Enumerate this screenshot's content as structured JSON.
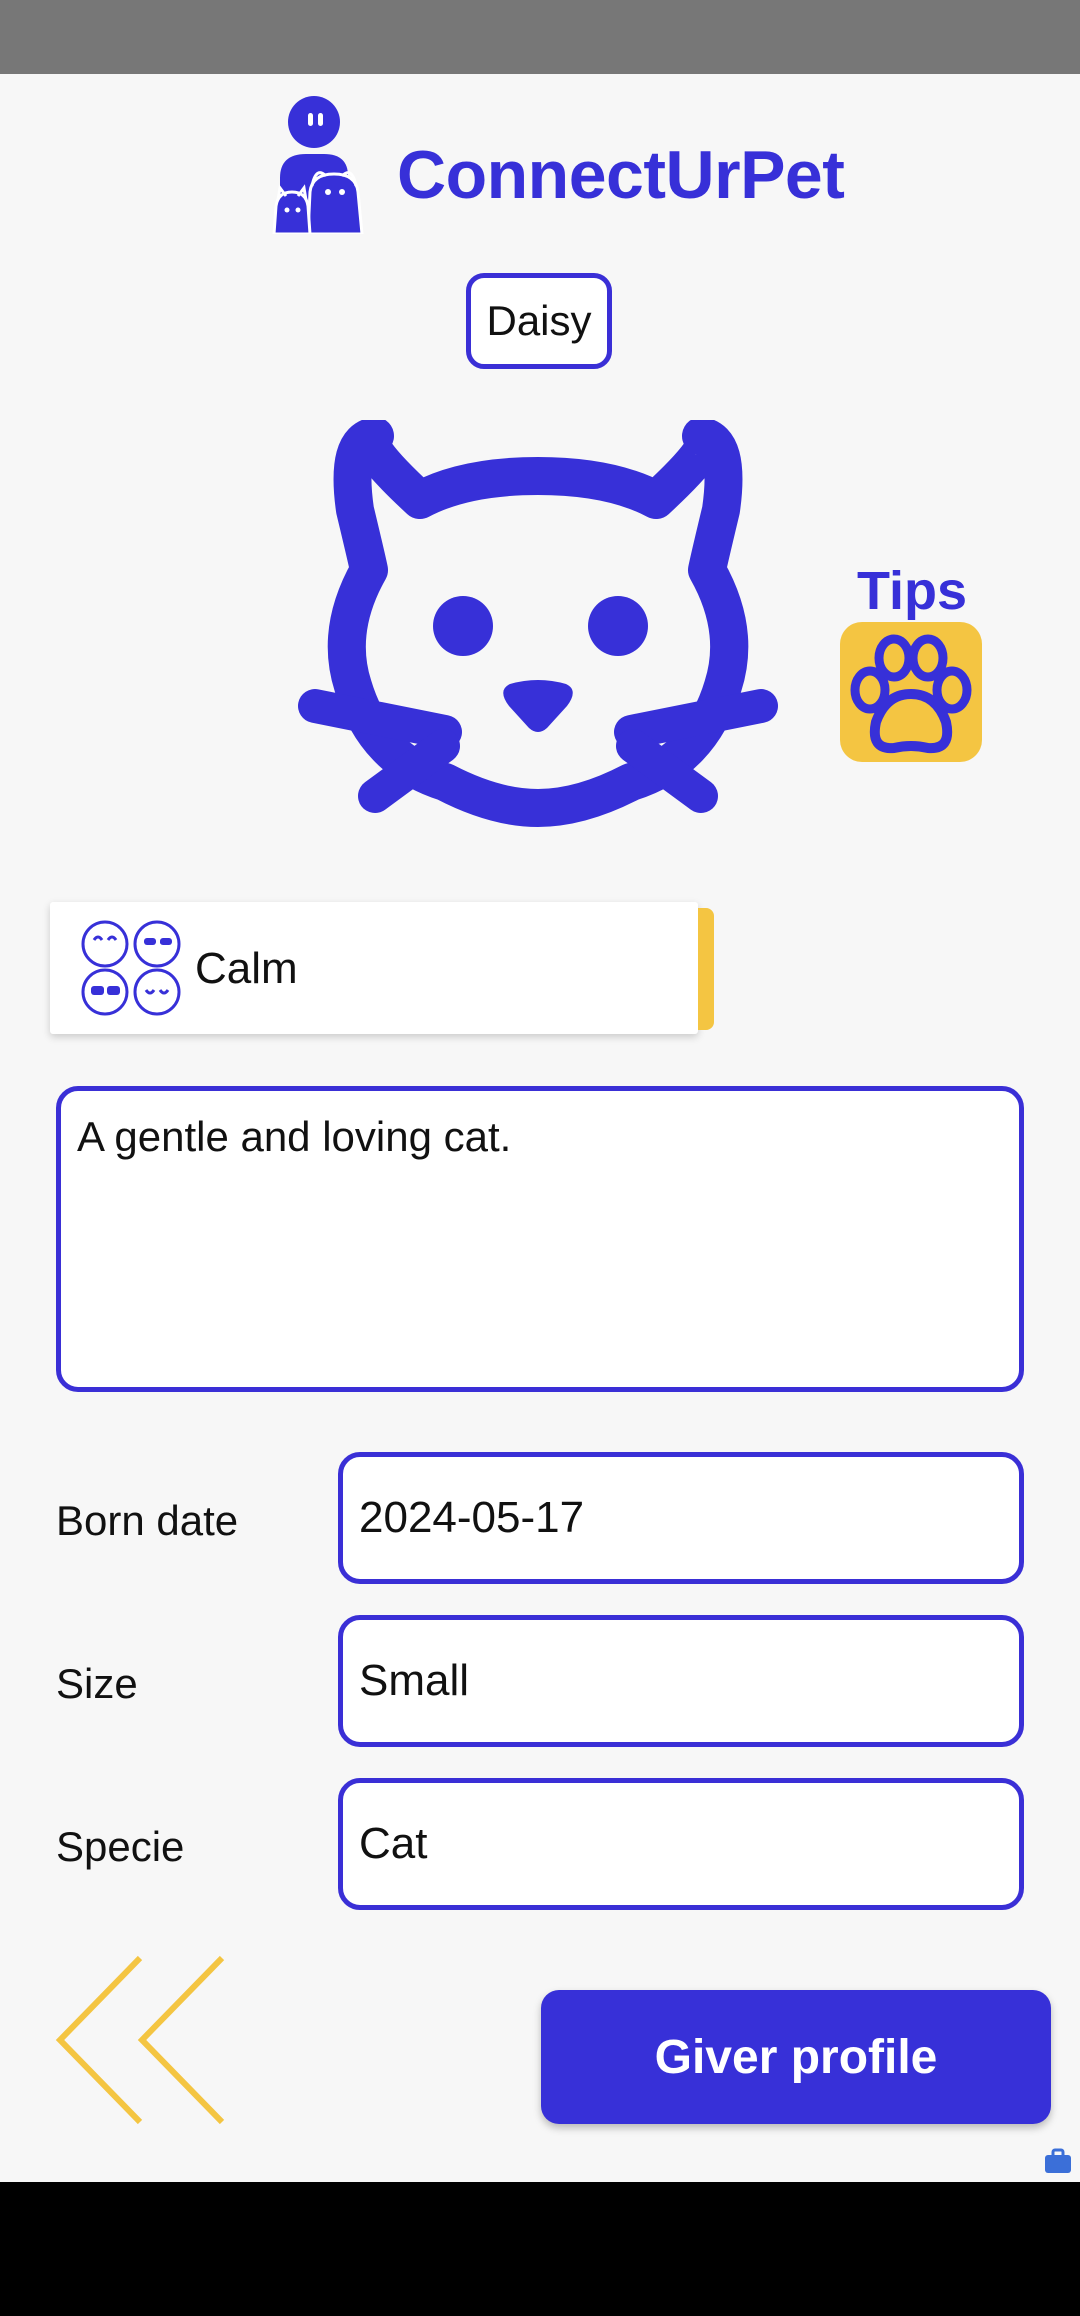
{
  "app": {
    "title": "ConnectUrPet",
    "logo_icon": "person-with-pets-icon"
  },
  "pet": {
    "name": "Daisy",
    "avatar_icon": "cat-face-icon"
  },
  "tips": {
    "label": "Tips",
    "icon": "paw-icon"
  },
  "temperament": {
    "icon": "moods-icon",
    "selected": "Calm"
  },
  "description": {
    "value": "A gentle and loving cat."
  },
  "fields": [
    {
      "label": "Born date",
      "value": "2024-05-17"
    },
    {
      "label": "Size",
      "value": "Small"
    },
    {
      "label": "Specie",
      "value": "Cat"
    }
  ],
  "actions": {
    "back_icon": "double-chevron-left-icon",
    "giver_profile_label": "Giver profile"
  },
  "colors": {
    "primary": "#3730d8",
    "accent": "#f4c542",
    "background": "#f7f7f7"
  }
}
